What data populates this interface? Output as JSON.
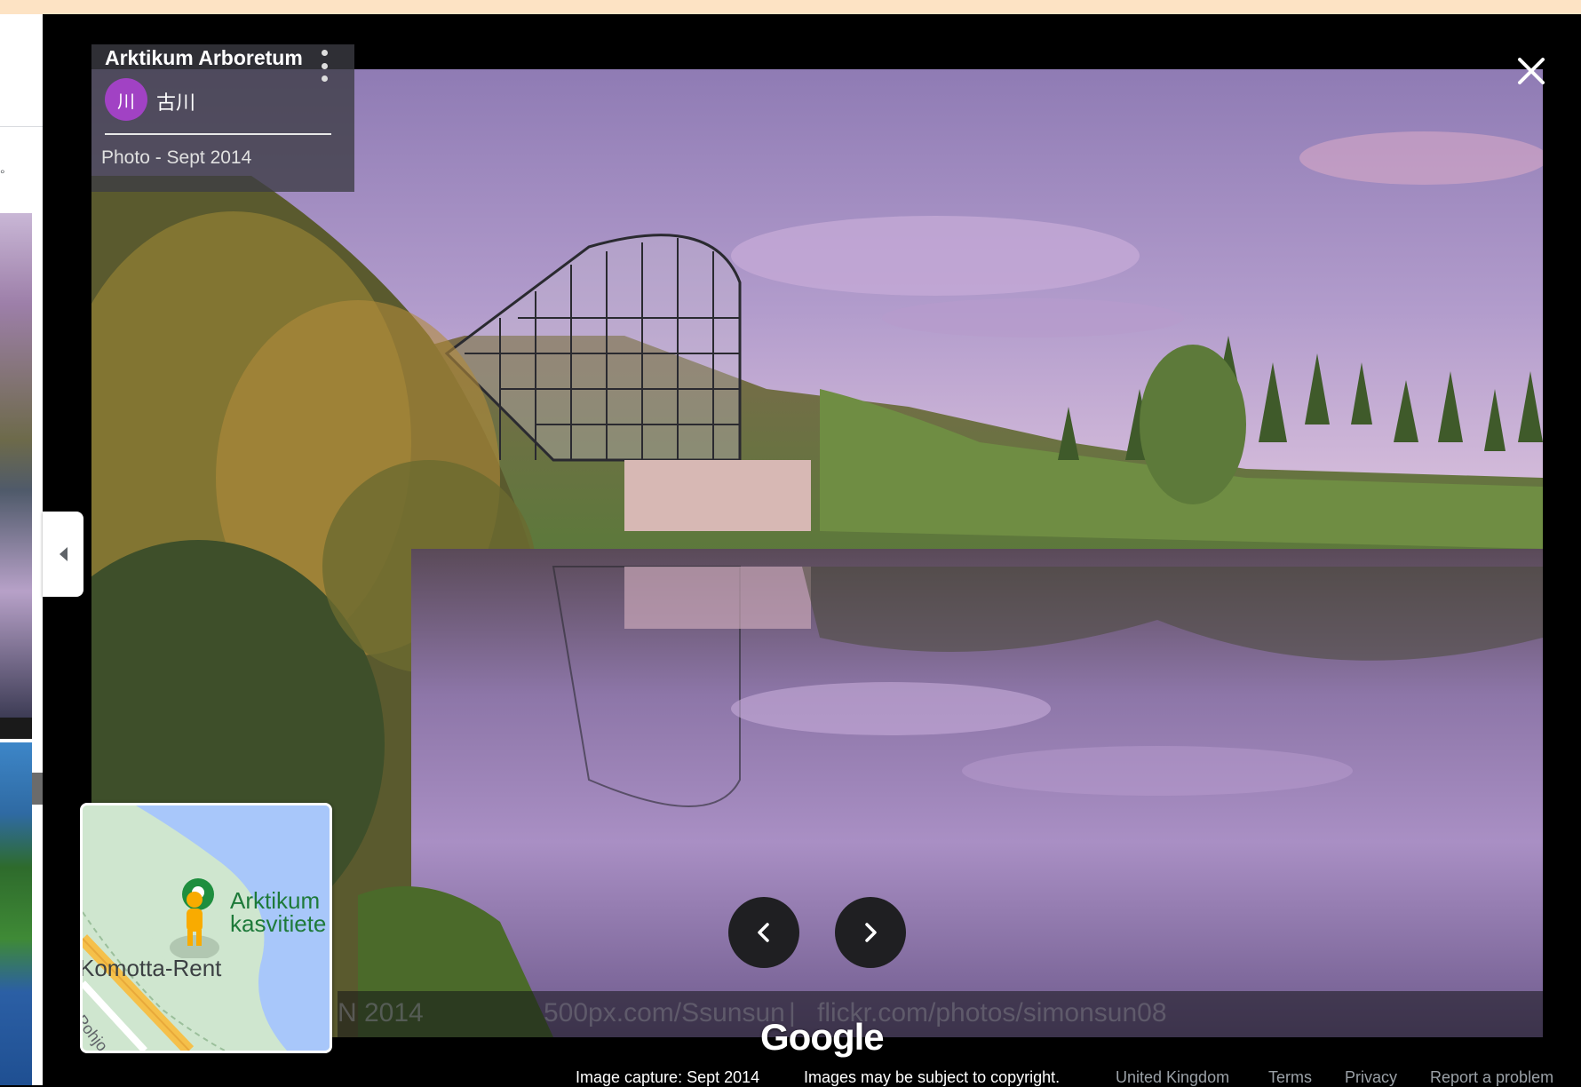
{
  "photo": {
    "place_title": "Arktikum Arboretum",
    "author_initials": "川",
    "author_name": "古川",
    "caption": "Photo - Sept 2014",
    "watermark_left": "N 2014",
    "watermark_mid": "500px.com/Ssunsun",
    "watermark_sep": "|",
    "watermark_right": "flickr.com/photos/simonsun08"
  },
  "minimap": {
    "label_line1": "Arktikum",
    "label_line2": "kasvitiete",
    "label_road": "Komotta-Rent",
    "label_street": "Pohjo"
  },
  "branding": {
    "logo": "Google"
  },
  "footer": {
    "capture": "Image capture: Sept 2014",
    "copyright": "Images may be subject to copyright.",
    "region": "United Kingdom",
    "terms": "Terms",
    "privacy": "Privacy",
    "report": "Report a problem"
  },
  "icons": {
    "close": "close-icon",
    "more": "more-vert-icon",
    "prev": "chevron-left-icon",
    "next": "chevron-right-icon",
    "collapse": "arrow-left-icon",
    "pegman": "pegman-icon",
    "place_pin": "place-pin-icon"
  },
  "colors": {
    "avatar": "#a142c4",
    "map_water": "#a8c7fa",
    "map_park": "#cfe6cf",
    "map_road": "#f5c04a",
    "top_strip": "#fde3c4"
  }
}
